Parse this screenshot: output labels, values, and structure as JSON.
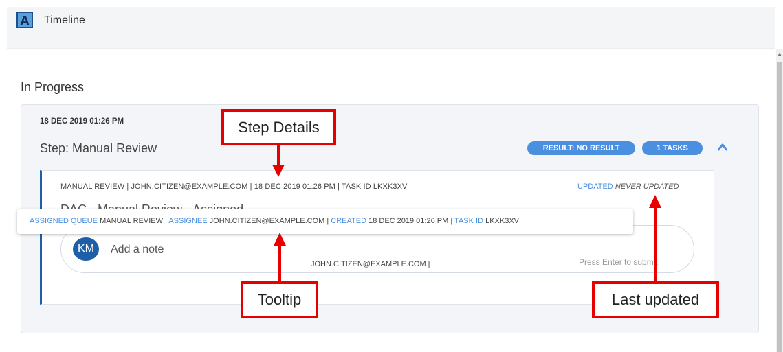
{
  "header": {
    "logo_letter": "A",
    "title": "Timeline"
  },
  "section": {
    "title": "In Progress"
  },
  "card": {
    "date": "18 DEC 2019 01:26 PM",
    "step_title": "Step: Manual Review",
    "badges": {
      "result": "RESULT: NO RESULT",
      "tasks": "1 TASKS"
    },
    "icon": "chevron-up-icon"
  },
  "detail": {
    "line": "MANUAL REVIEW | JOHN.CITIZEN@EXAMPLE.COM | 18 DEC 2019 01:26 PM | TASK ID LKXK3XV",
    "updated_label": "UPDATED",
    "updated_value": "NEVER UPDATED",
    "event_title": "DAC - Manual Review - Assigned"
  },
  "note": {
    "avatar_initials": "KM",
    "placeholder": "Add a note",
    "email": "JOHN.CITIZEN@EXAMPLE.COM |",
    "hint": "Press Enter to submit"
  },
  "tooltip": {
    "assigned_queue_label": "ASSIGNED QUEUE",
    "assigned_queue_value": "MANUAL REVIEW |",
    "assignee_label": "ASSIGNEE",
    "assignee_value": "JOHN.CITIZEN@EXAMPLE.COM |",
    "created_label": "CREATED",
    "created_value": "18 DEC 2019 01:26 PM |",
    "task_id_label": "TASK ID",
    "task_id_value": "LKXK3XV"
  },
  "callouts": {
    "step_details": "Step Details",
    "tooltip": "Tooltip",
    "last_updated": "Last updated"
  },
  "colors": {
    "accent": "#4a8fe0",
    "annotation": "#e60000",
    "brand": "#1f5fa8"
  }
}
